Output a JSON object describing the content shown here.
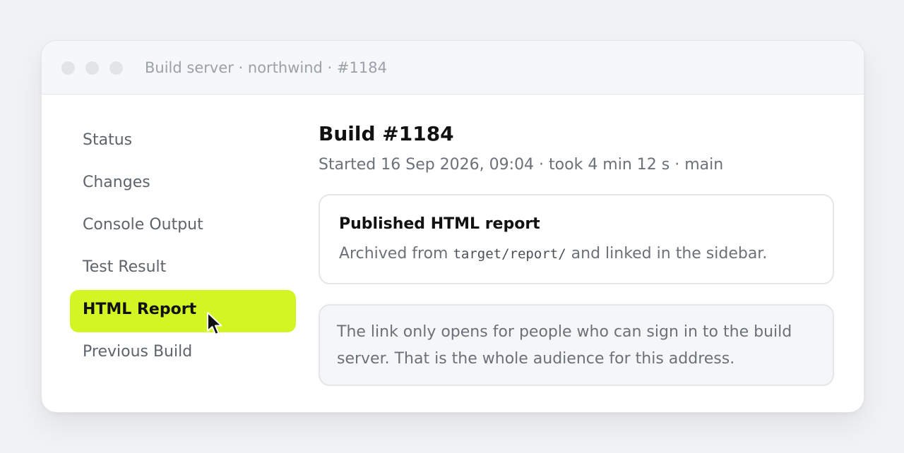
{
  "window": {
    "title": "Build server · northwind · #1184"
  },
  "sidebar": {
    "items": [
      {
        "label": "Status",
        "active": false
      },
      {
        "label": "Changes",
        "active": false
      },
      {
        "label": "Console Output",
        "active": false
      },
      {
        "label": "Test Result",
        "active": false
      },
      {
        "label": "HTML Report",
        "active": true
      },
      {
        "label": "Previous Build",
        "active": false
      }
    ]
  },
  "main": {
    "title": "Build #1184",
    "meta": "Started 16 Sep 2026, 09:04 · took 4 min 12 s · main",
    "report_card": {
      "title": "Published HTML report",
      "body_prefix": "Archived from",
      "path": "target/report/",
      "body_suffix": "and linked in the sidebar."
    },
    "note": "The link only opens for people who can sign in to the build server. That is the whole audience for this address."
  },
  "colors": {
    "accent": "#d4f524",
    "background": "#f1f2f4",
    "text_primary": "#111111",
    "text_secondary": "#6b7178"
  },
  "icons": {
    "cursor": "mouse-pointer-icon"
  }
}
